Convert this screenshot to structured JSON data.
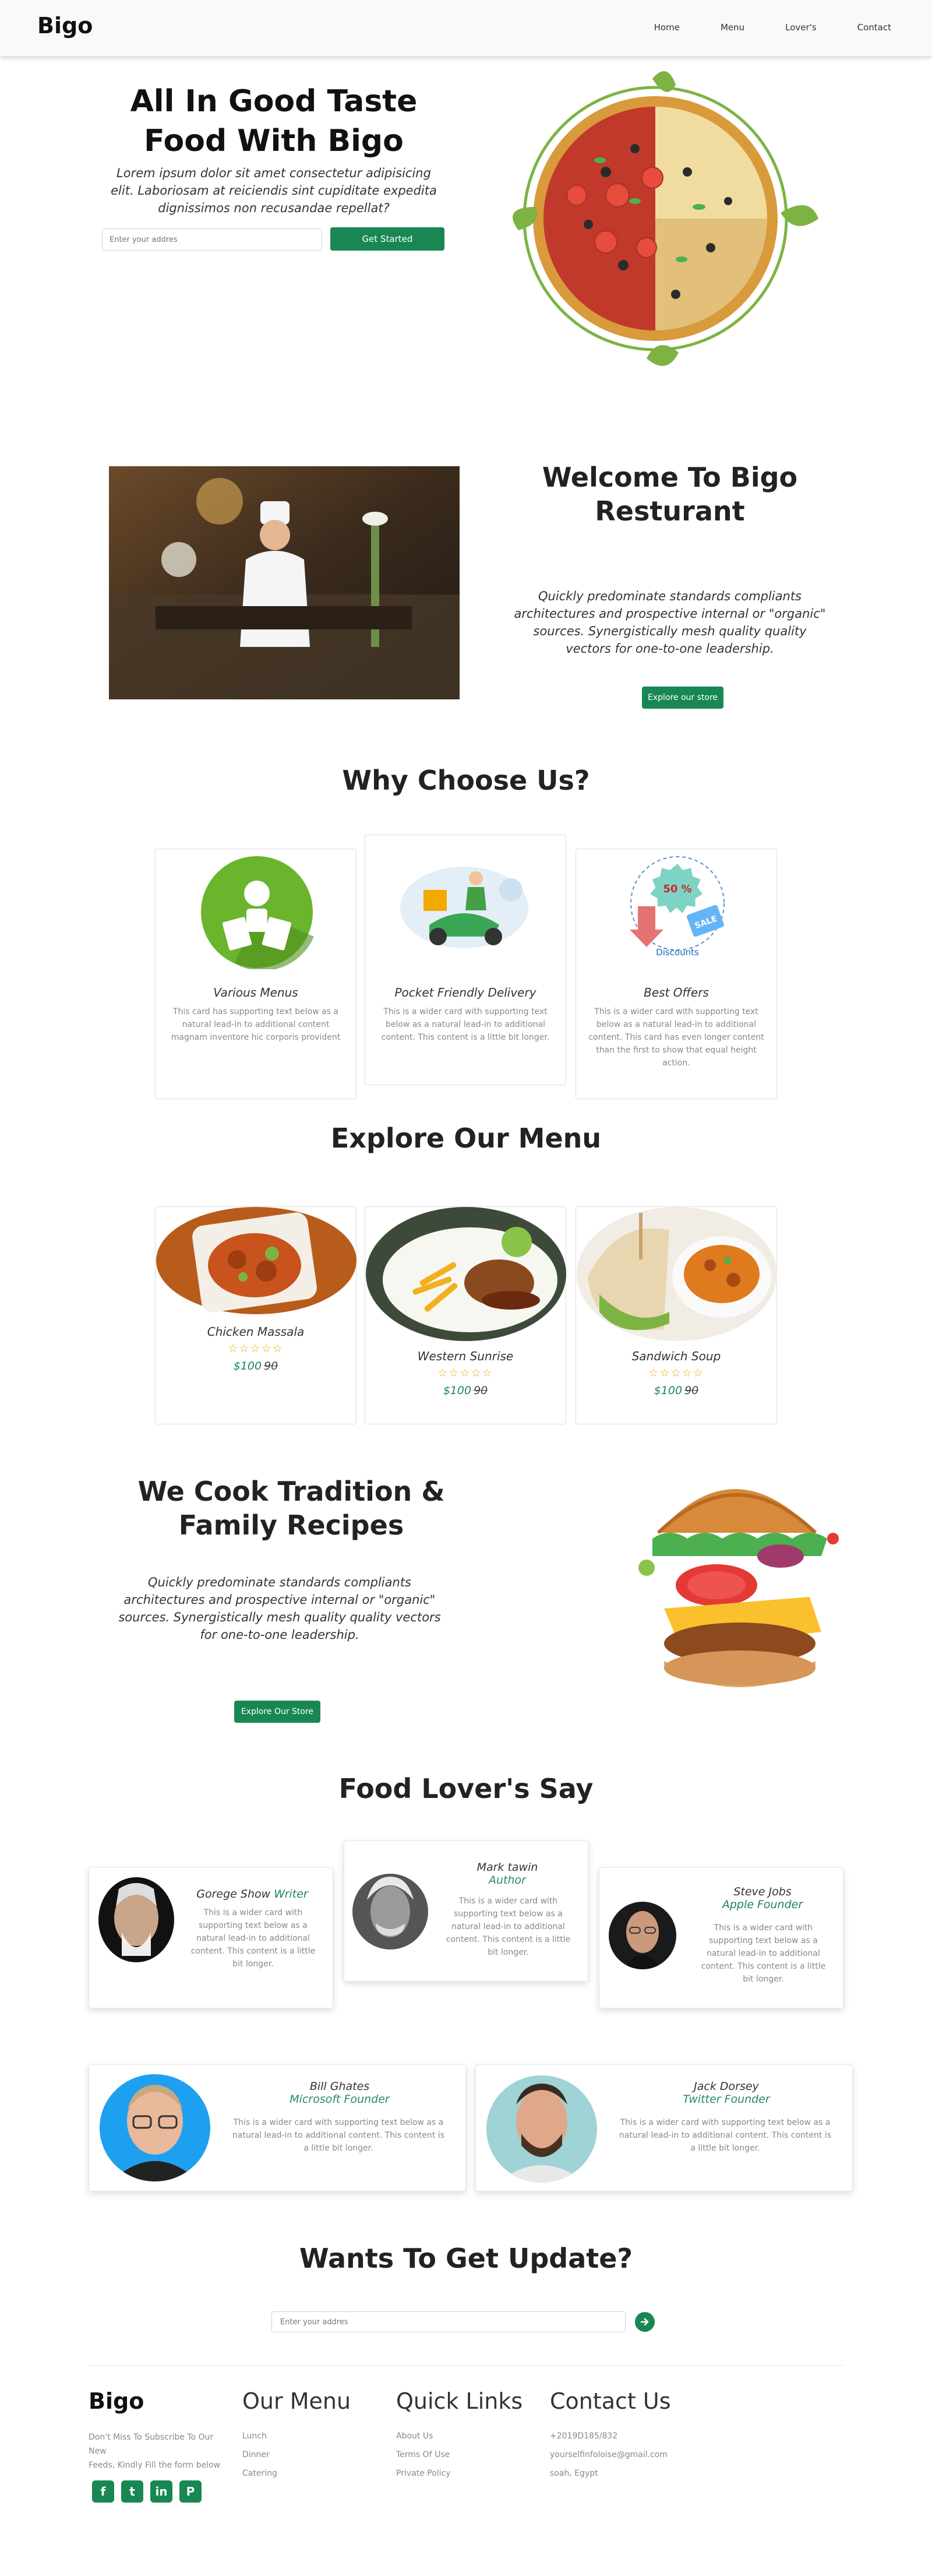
{
  "nav": {
    "brand": "Bigo",
    "links": [
      "Home",
      "Menu",
      "Lover's",
      "Contact"
    ]
  },
  "hero": {
    "title_line1": "All In Good Taste",
    "title_line2": "Food With Bigo",
    "subtitle": "Lorem ipsum dolor sit amet consectetur adipisicing elit. Laboriosam at reiciendis sint cupiditate expedita dignissimos non recusandae repellat?",
    "input_placeholder": "Enter your addres",
    "button": "Get Started"
  },
  "welcome": {
    "title_line1": "Welcome To Bigo",
    "title_line2": "Resturant",
    "text": "Quickly predominate standards compliants architectures and prospective internal or \"organic\" sources. Synergistically mesh quality quality vectors for one-to-one leadership.",
    "button": "Explore our store"
  },
  "why": {
    "title": "Why Choose Us?",
    "discount_label": "Discounts",
    "discount_badge": "50 %",
    "discount_tag": "SALE",
    "cards": [
      {
        "title": "Various Menus",
        "text": "This card has supporting text below as a natural lead-in to additional content magnam inventore hic corporis provident"
      },
      {
        "title": "Pocket Friendly Delivery",
        "text": "This is a wider card with supporting text below as a natural lead-in to additional content. This content is a little bit longer."
      },
      {
        "title": "Best Offers",
        "text": "This is a wider card with supporting text below as a natural lead-in to additional content. This card has even longer content than the first to show that equal height action."
      }
    ]
  },
  "menu": {
    "title": "Explore Our Menu",
    "items": [
      {
        "name": "Chicken Massala",
        "stars": "☆☆☆☆☆",
        "price": "$100",
        "old_price": "90"
      },
      {
        "name": "Western Sunrise",
        "stars": "☆☆☆☆☆",
        "price": "$100",
        "old_price": "90"
      },
      {
        "name": "Sandwich Soup",
        "stars": "☆☆☆☆☆",
        "price": "$100",
        "old_price": "90"
      }
    ]
  },
  "tradition": {
    "title_line1": "We Cook Tradition &",
    "title_line2": "Family Recipes",
    "text": "Quickly predominate standards compliants architectures and prospective internal or \"organic\" sources. Synergistically mesh quality quality vectors for one-to-one leadership.",
    "button": "Explore Our Store"
  },
  "lovers": {
    "title": "Food Lover's Say",
    "row1": [
      {
        "name": "Gorege Show",
        "role": "Writer",
        "text": "This is a wider card with supporting text below as a natural lead-in to additional content. This content is a little bit longer."
      },
      {
        "name": "Mark tawin",
        "role": "Author",
        "text": "This is a wider card with supporting text below as a natural lead-in to additional content. This content is a little bit longer."
      },
      {
        "name": "Steve Jobs",
        "role": "Apple Founder",
        "text": "This is a wider card with supporting text below as a natural lead-in to additional content. This content is a little bit longer."
      }
    ],
    "row2": [
      {
        "name": "Bill Ghates",
        "role": "Microsoft Founder",
        "text": "This is a wider card with supporting text below as a natural lead-in to additional content. This content is a little bit longer."
      },
      {
        "name": "Jack Dorsey",
        "role": "Twitter Founder",
        "text": "This is a wider card with supporting text below as a natural lead-in to additional content. This content is a little bit longer."
      }
    ]
  },
  "update": {
    "title": "Wants To Get Update?",
    "input_placeholder": "Enter your addres"
  },
  "footer": {
    "brand": "Bigo",
    "about_line1": "Don't Miss To Subscribe To Our New",
    "about_line2": "Feeds, Kindly Fill the form below",
    "menu_head": "Our Menu",
    "menu_links": [
      "Lunch",
      "Dinner",
      "Catering"
    ],
    "quick_head": "Quick Links",
    "quick_links": [
      "About Us",
      "Terms Of Use",
      "Private Policy"
    ],
    "contact_head": "Contact Us",
    "contact_lines": [
      "+2019D185/832",
      "yourselfinfoloise@gmail.com",
      "soah, Egypt"
    ],
    "social_icons": [
      "facebook-icon",
      "twitter-icon",
      "linkedin-icon",
      "pinterest-icon"
    ]
  },
  "colors": {
    "accent": "#198754",
    "star": "#e0b000"
  }
}
